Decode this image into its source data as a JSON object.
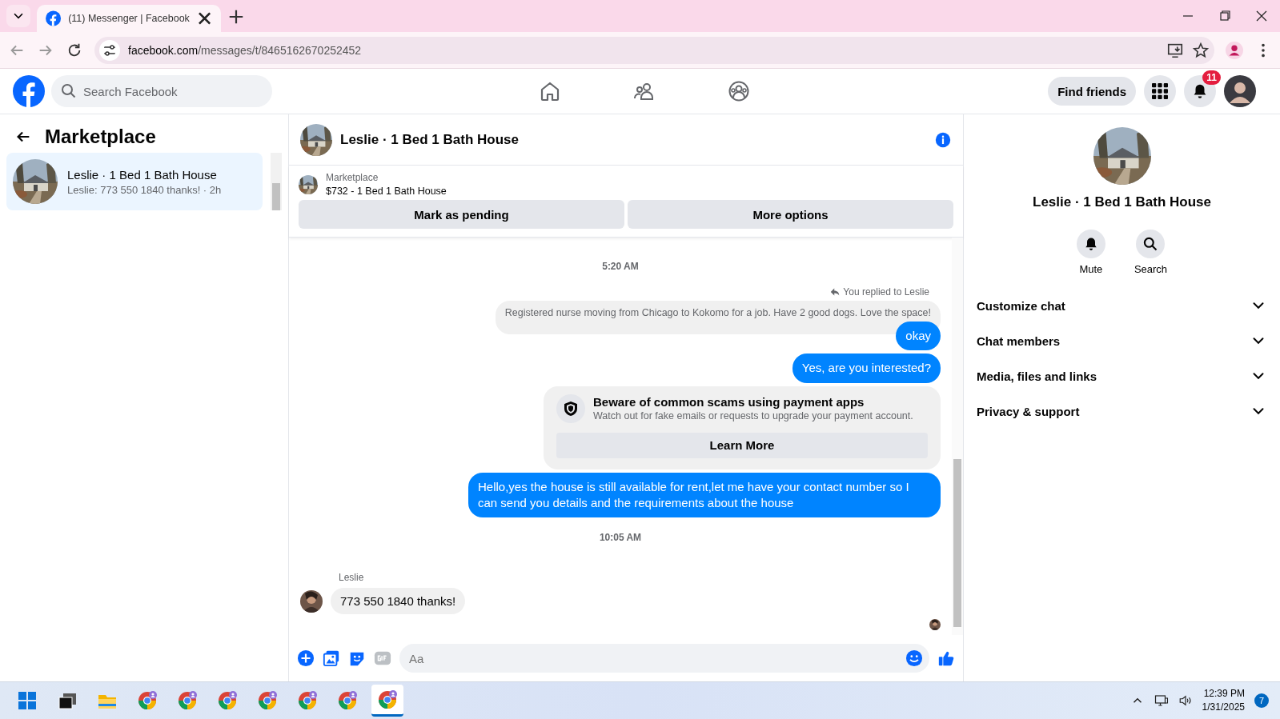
{
  "browser": {
    "tabs": [
      {
        "title": "(11) Messenger | Facebook",
        "selected": true
      }
    ],
    "url_host": "facebook.com",
    "url_path": "/messages/t/8465162670252452"
  },
  "header": {
    "search_placeholder": "Search Facebook",
    "nav": [
      {
        "kind": "home",
        "selected": false
      },
      {
        "kind": "friends",
        "selected": false
      },
      {
        "kind": "groups",
        "selected": false
      }
    ],
    "find_friends": "Find friends",
    "notification_count": "11"
  },
  "sidebar": {
    "title": "Marketplace",
    "conversations": [
      {
        "name": "Leslie · 1 Bed 1 Bath House",
        "preview": "Leslie: 773 550 1840 thanks! · 2h",
        "selected": true
      }
    ]
  },
  "chat": {
    "title": "Leslie · 1 Bed 1 Bath House",
    "listing": {
      "source": "Marketplace",
      "title": "$732 - 1 Bed 1 Bath House"
    },
    "actions": [
      "Mark as pending",
      "More options"
    ],
    "messages": [
      {
        "kind": "timestamp",
        "text": "5:20 AM"
      },
      {
        "kind": "reply_note",
        "text": "You replied to Leslie"
      },
      {
        "kind": "quoted",
        "text": "Registered nurse moving from Chicago to Kokomo for a job. Have 2 good dogs. Love the space!"
      },
      {
        "kind": "outgoing",
        "text": "okay"
      },
      {
        "kind": "outgoing",
        "text": "Yes, are you interested?"
      },
      {
        "kind": "warning",
        "title": "Beware of common scams using payment apps",
        "text": "Watch out for fake emails or requests to upgrade your payment account.",
        "button": "Learn More"
      },
      {
        "kind": "outgoing",
        "text": "Hello,yes the house is still available for rent,let me have your contact number   so I can send you details and the requirements about the house"
      },
      {
        "kind": "timestamp",
        "text": "10:05 AM"
      },
      {
        "kind": "incoming",
        "sender": "Leslie",
        "text": "773 550 1840 thanks!"
      }
    ],
    "composer_placeholder": "Aa"
  },
  "details": {
    "name": "Leslie · 1 Bed 1 Bath House",
    "actions": [
      {
        "kind": "bell",
        "label": "Mute"
      },
      {
        "kind": "search",
        "label": "Search"
      }
    ],
    "sections": [
      {
        "label": "Customize chat",
        "expanded": false
      },
      {
        "label": "Chat members",
        "expanded": false
      },
      {
        "label": "Media, files and links",
        "expanded": false
      },
      {
        "label": "Privacy & support",
        "expanded": false
      }
    ]
  },
  "taskbar": {
    "apps": [
      {
        "kind": "start",
        "selected": false
      },
      {
        "kind": "task-view",
        "selected": false
      },
      {
        "kind": "folder",
        "selected": false
      },
      {
        "kind": "browser",
        "selected": false
      },
      {
        "kind": "browser",
        "selected": false
      },
      {
        "kind": "browser",
        "selected": false
      },
      {
        "kind": "browser",
        "selected": false
      },
      {
        "kind": "browser",
        "selected": false
      },
      {
        "kind": "browser",
        "selected": false
      },
      {
        "kind": "browser",
        "selected": true
      }
    ],
    "time": "12:39 PM",
    "date": "1/31/2025",
    "notification_count": "7"
  }
}
